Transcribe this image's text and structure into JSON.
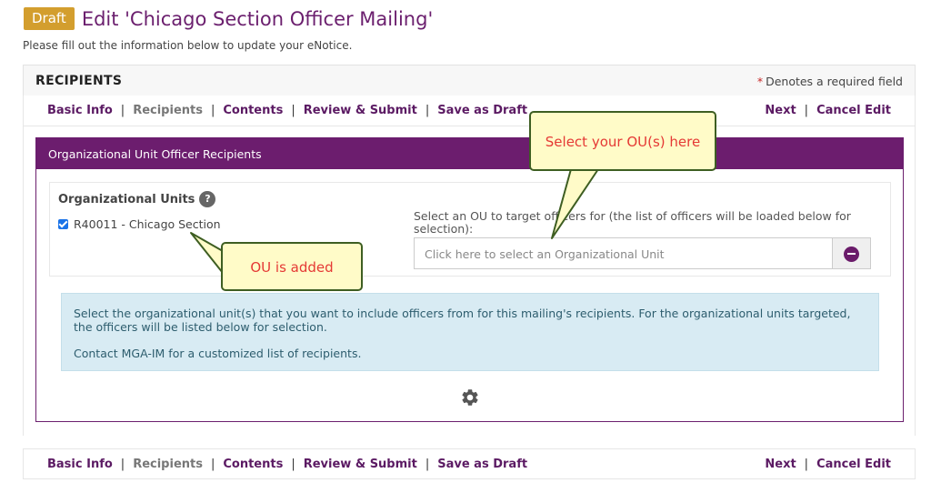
{
  "header": {
    "badge": "Draft",
    "title": "Edit 'Chicago Section Officer Mailing'",
    "subtitle": "Please fill out the information below to update your eNotice."
  },
  "section": {
    "title": "RECIPIENTS",
    "required_star": "*",
    "required_note": "Denotes a required field"
  },
  "nav": {
    "basic_info": "Basic Info",
    "recipients": "Recipients",
    "contents": "Contents",
    "review_submit": "Review & Submit",
    "save_draft": "Save as Draft",
    "next": "Next",
    "cancel_edit": "Cancel Edit",
    "separator": "|"
  },
  "ou_panel": {
    "header": "Organizational Unit Officer Recipients",
    "units_label": "Organizational Units",
    "help_glyph": "?",
    "selected_unit": "R40011 - Chicago Section",
    "select_label": "Select an OU to target officers for (the list of officers will be loaded below for selection):",
    "select_placeholder": "Click here to select an Organizational Unit",
    "info_line1": "Select the organizational unit(s) that you want to include officers from for this mailing's recipients. For the organizational units targeted, the officers will be listed below for selection.",
    "info_line2": "Contact MGA-IM for a customized list of recipients."
  },
  "callouts": {
    "select_ou": "Select your OU(s) here",
    "ou_added": "OU is added"
  },
  "colors": {
    "brand_purple": "#6c1d6e",
    "draft_badge": "#d39e2e",
    "info_bg": "#d8ebf3",
    "callout_bg": "#fffbc8",
    "callout_text": "#e53935"
  },
  "icons": {
    "help": "help-circle-icon",
    "remove": "minus-circle-icon",
    "loading": "gear-icon",
    "checkbox": "checkbox-checked-icon"
  }
}
